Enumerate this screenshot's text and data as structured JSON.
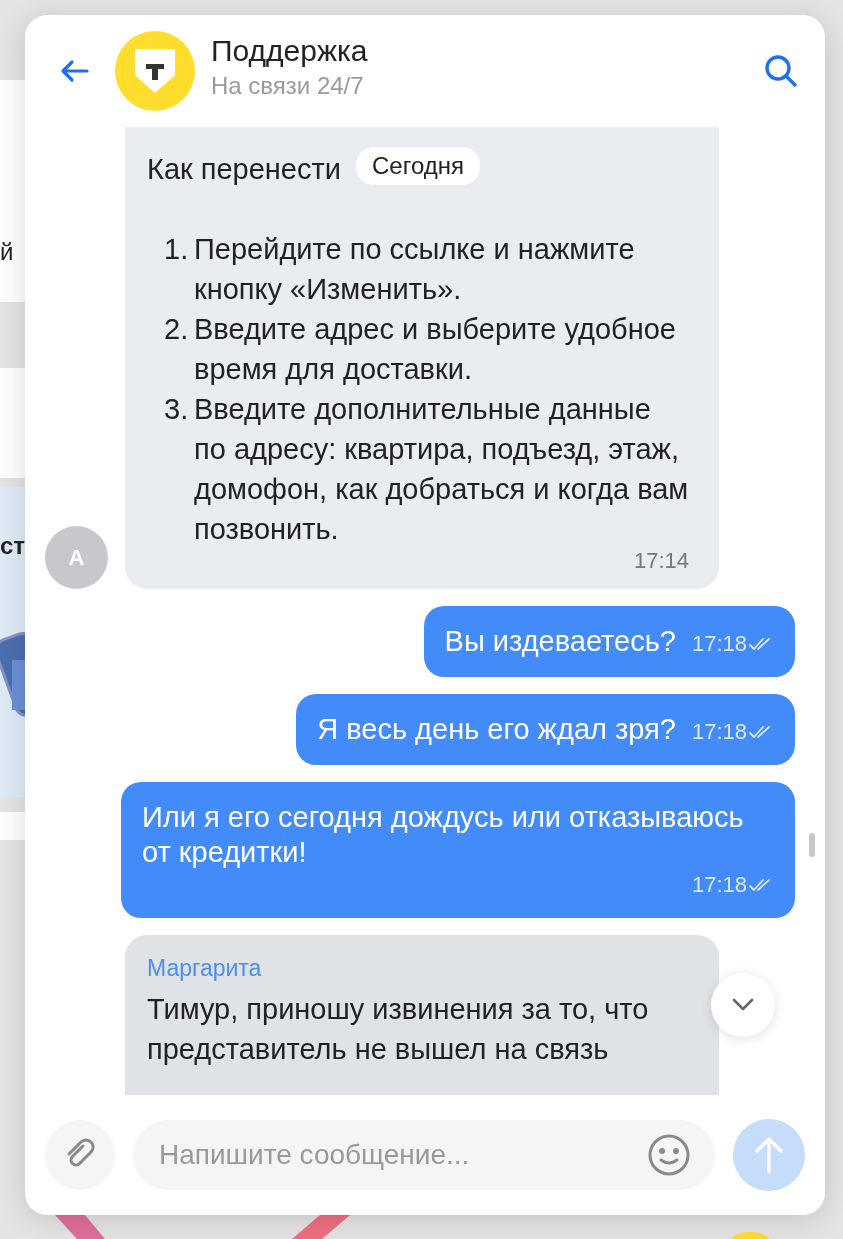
{
  "background": {
    "fragments": [
      {
        "text": "й"
      },
      {
        "text": "ст"
      }
    ]
  },
  "header": {
    "title": "Поддержка",
    "subtitle": "На связи 24/7"
  },
  "date_badge": "Сегодня",
  "messages": [
    {
      "kind": "incoming",
      "avatar": "A",
      "text": "Как перенести",
      "list": [
        {
          "number": "1.",
          "text": "Перейдите по ссылке и нажмите кнопку «Изменить»."
        },
        {
          "number": "2.",
          "text": "Введите адрес и выберите удобное время для доставки."
        },
        {
          "number": "3.",
          "text": "Введите дополнительные данные по адресу: квартира, подъезд, этаж, домофон, как добраться и когда вам позвонить."
        }
      ],
      "time": "17:14"
    },
    {
      "kind": "outgoing",
      "text": "Вы издеваетесь?",
      "time": "17:18",
      "read": true
    },
    {
      "kind": "outgoing",
      "text": "Я весь день его ждал зря?",
      "time": "17:18",
      "read": true
    },
    {
      "kind": "outgoing",
      "text": "Или я его сегодня дождусь или отказываюсь от кредитки!",
      "time": "17:18",
      "read": true
    },
    {
      "kind": "incoming",
      "author": "Маргарита",
      "text": "Тимур, приношу извинения за то, что представитель не вышел на связь"
    }
  ],
  "composer": {
    "placeholder": "Напишите сообщение..."
  }
}
